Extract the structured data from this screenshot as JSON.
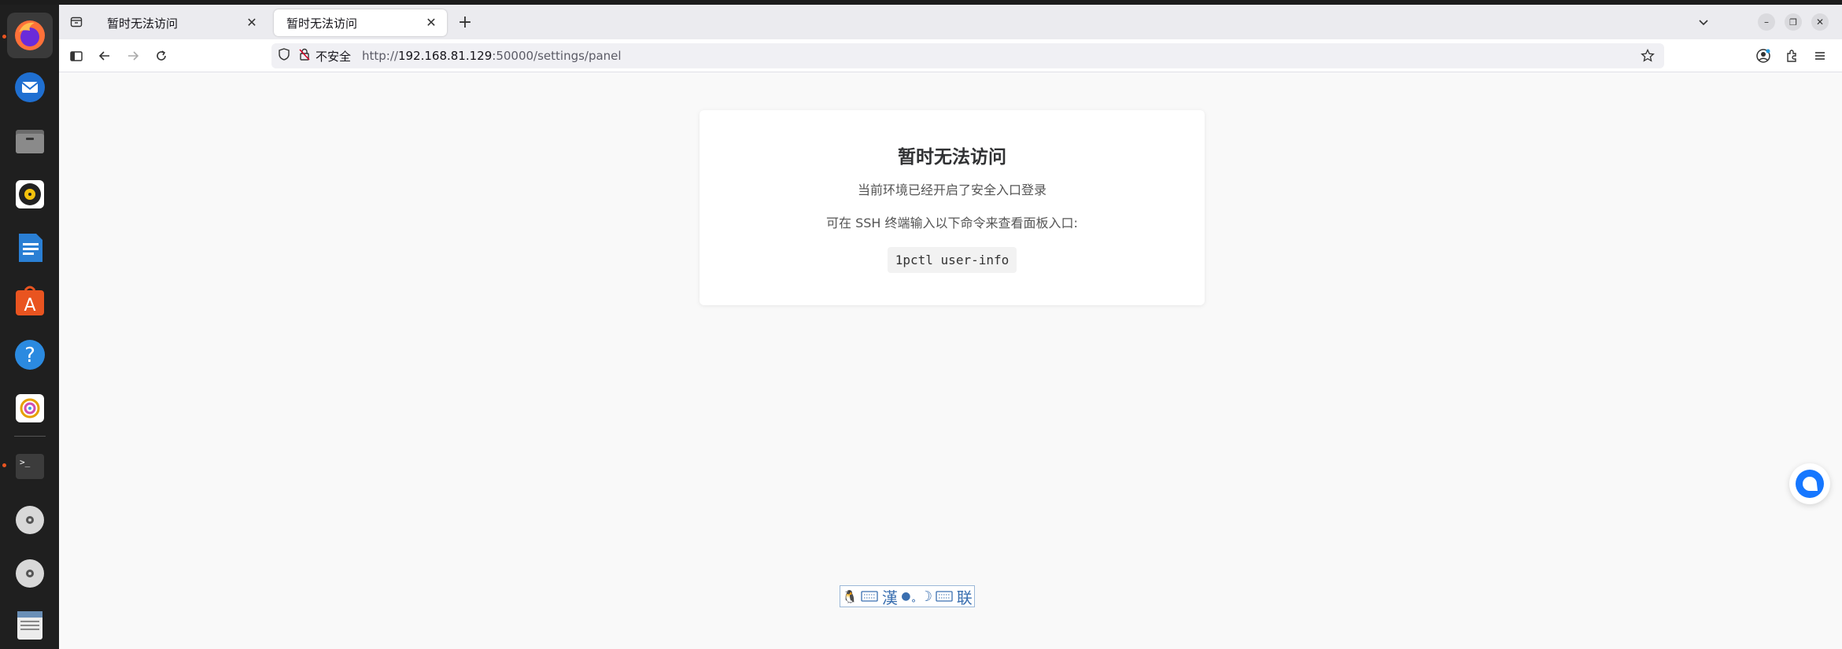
{
  "tabs": [
    {
      "title": "暂时无法访问",
      "active": false
    },
    {
      "title": "暂时无法访问",
      "active": true
    }
  ],
  "navbar": {
    "security_label": "不安全",
    "url_prefix": "http://",
    "url_host": "192.168.81.129",
    "url_rest": ":50000/settings/panel"
  },
  "card": {
    "title": "暂时无法访问",
    "line1": "当前环境已经开启了安全入口登录",
    "line2": "可在 SSH 终端输入以下命令来查看面板入口:",
    "command": "1pctl user-info"
  },
  "ime": {
    "han": "漢",
    "lian": "联"
  },
  "colors": {
    "accent": "#1677ff",
    "ubuntu_orange": "#e95420"
  },
  "dock_icons": [
    "firefox-icon",
    "thunderbird-icon",
    "files-icon",
    "rhythmbox-icon",
    "writer-icon",
    "app-center-icon",
    "help-icon",
    "image-viewer-icon",
    "terminal-icon",
    "dvd-icon",
    "dvd-icon",
    "text-editor-icon"
  ]
}
